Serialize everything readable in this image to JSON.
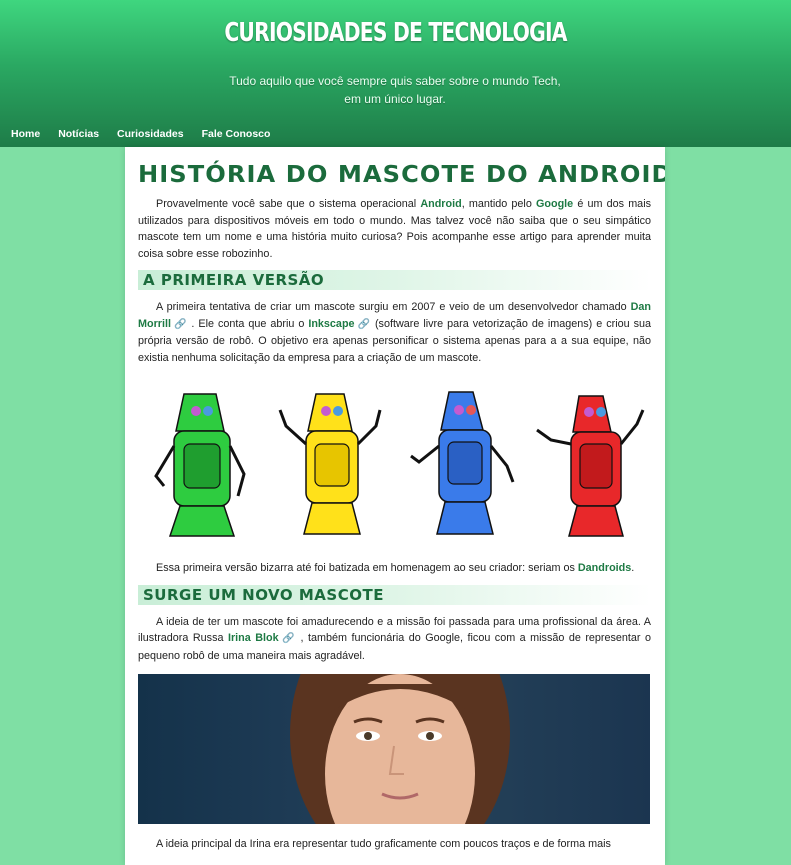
{
  "header": {
    "title": "CURIOSIDADES DE TECNOLOGIA",
    "subtitle": "Tudo aquilo que você sempre quis saber sobre o mundo Tech, em um único lugar."
  },
  "nav": [
    "Home",
    "Notícias",
    "Curiosidades",
    "Fale Conosco"
  ],
  "article": {
    "title": "História do mascote do Android",
    "intro": {
      "t1": "Provavelmente você sabe que o sistema operacional ",
      "h1": "Android",
      "t2": ", mantido pelo ",
      "h2": "Google",
      "t3": " é um dos mais utilizados para dispositivos móveis em todo o mundo. Mas talvez você não saiba que o seu simpático mascote tem um nome e uma história muito curiosa? Pois acompanhe esse artigo para aprender muita coisa sobre esse robozinho."
    },
    "section1": "A primeira versão",
    "p1": {
      "t1": "A primeira tentativa de criar um mascote surgiu em 2007 e veio de um desenvolvedor chamado ",
      "l1": "Dan Morrill",
      "t2": " . Ele conta que abriu o ",
      "l2": "Inkscape",
      "t3": " (software livre para vetorização de imagens) e criou sua própria versão de robô. O objetivo era apenas personificar o sistema apenas para a a sua equipe, não existia nenhuma solicitação da empresa para a criação de um mascote."
    },
    "p2": {
      "t1": "Essa primeira versão bizarra até foi batizada em homenagem ao seu criador: seriam os ",
      "h1": "Dandroids",
      "t2": "."
    },
    "section2": "Surge um novo mascote",
    "p3": {
      "t1": "A ideia de ter um mascote foi amadurecendo e a missão foi passada para uma profissional da área. A ilustradora Russa ",
      "l1": "Irina Blok",
      "t2": " , também funcionária do Google, ficou com a missão de representar o pequeno robô de uma maneira mais agradável."
    },
    "p4": "A ideia principal da Irina era representar tudo graficamente com poucos traços e de forma mais"
  },
  "colors": {
    "accent": "#1e7a44",
    "background": "#7fdfa4",
    "robots": [
      "#2ecc40",
      "#ffe11a",
      "#3a7bea",
      "#e8282a"
    ]
  }
}
